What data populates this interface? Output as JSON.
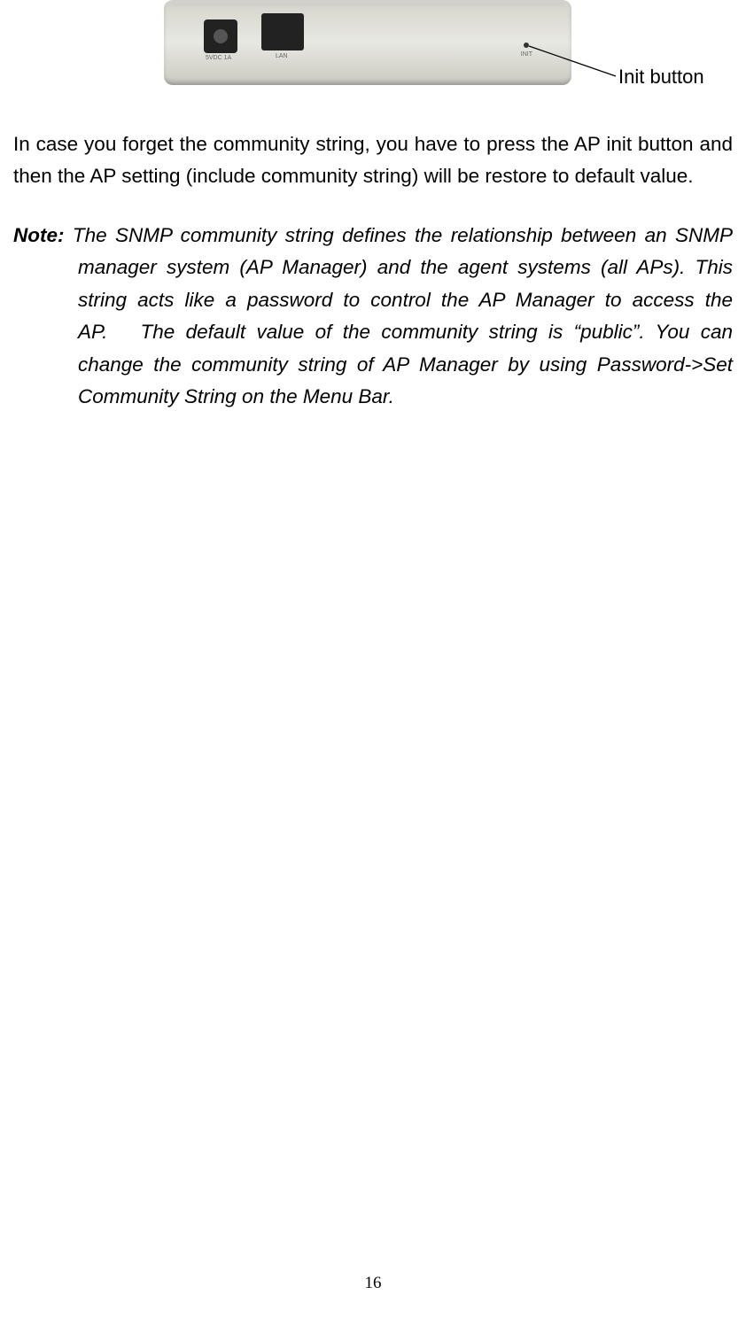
{
  "callout_label": "Init button",
  "port_labels": {
    "dc": "5VDC 1A",
    "lan": "LAN",
    "init": "INIT"
  },
  "paragraph_1": "In case you forget the community string, you have to press the AP init button and then the AP setting (include community string) will be restore to default value.",
  "note_label": "Note:",
  "note_body": " The SNMP community string defines the relationship between an SNMP manager system (AP Manager) and the agent systems (all APs). This string acts like a password to control the AP Manager to access the AP.   The default value of the community string is “public”. You can change the community string of AP Manager by using Password->Set Community String on the Menu Bar.",
  "page_number": "16"
}
